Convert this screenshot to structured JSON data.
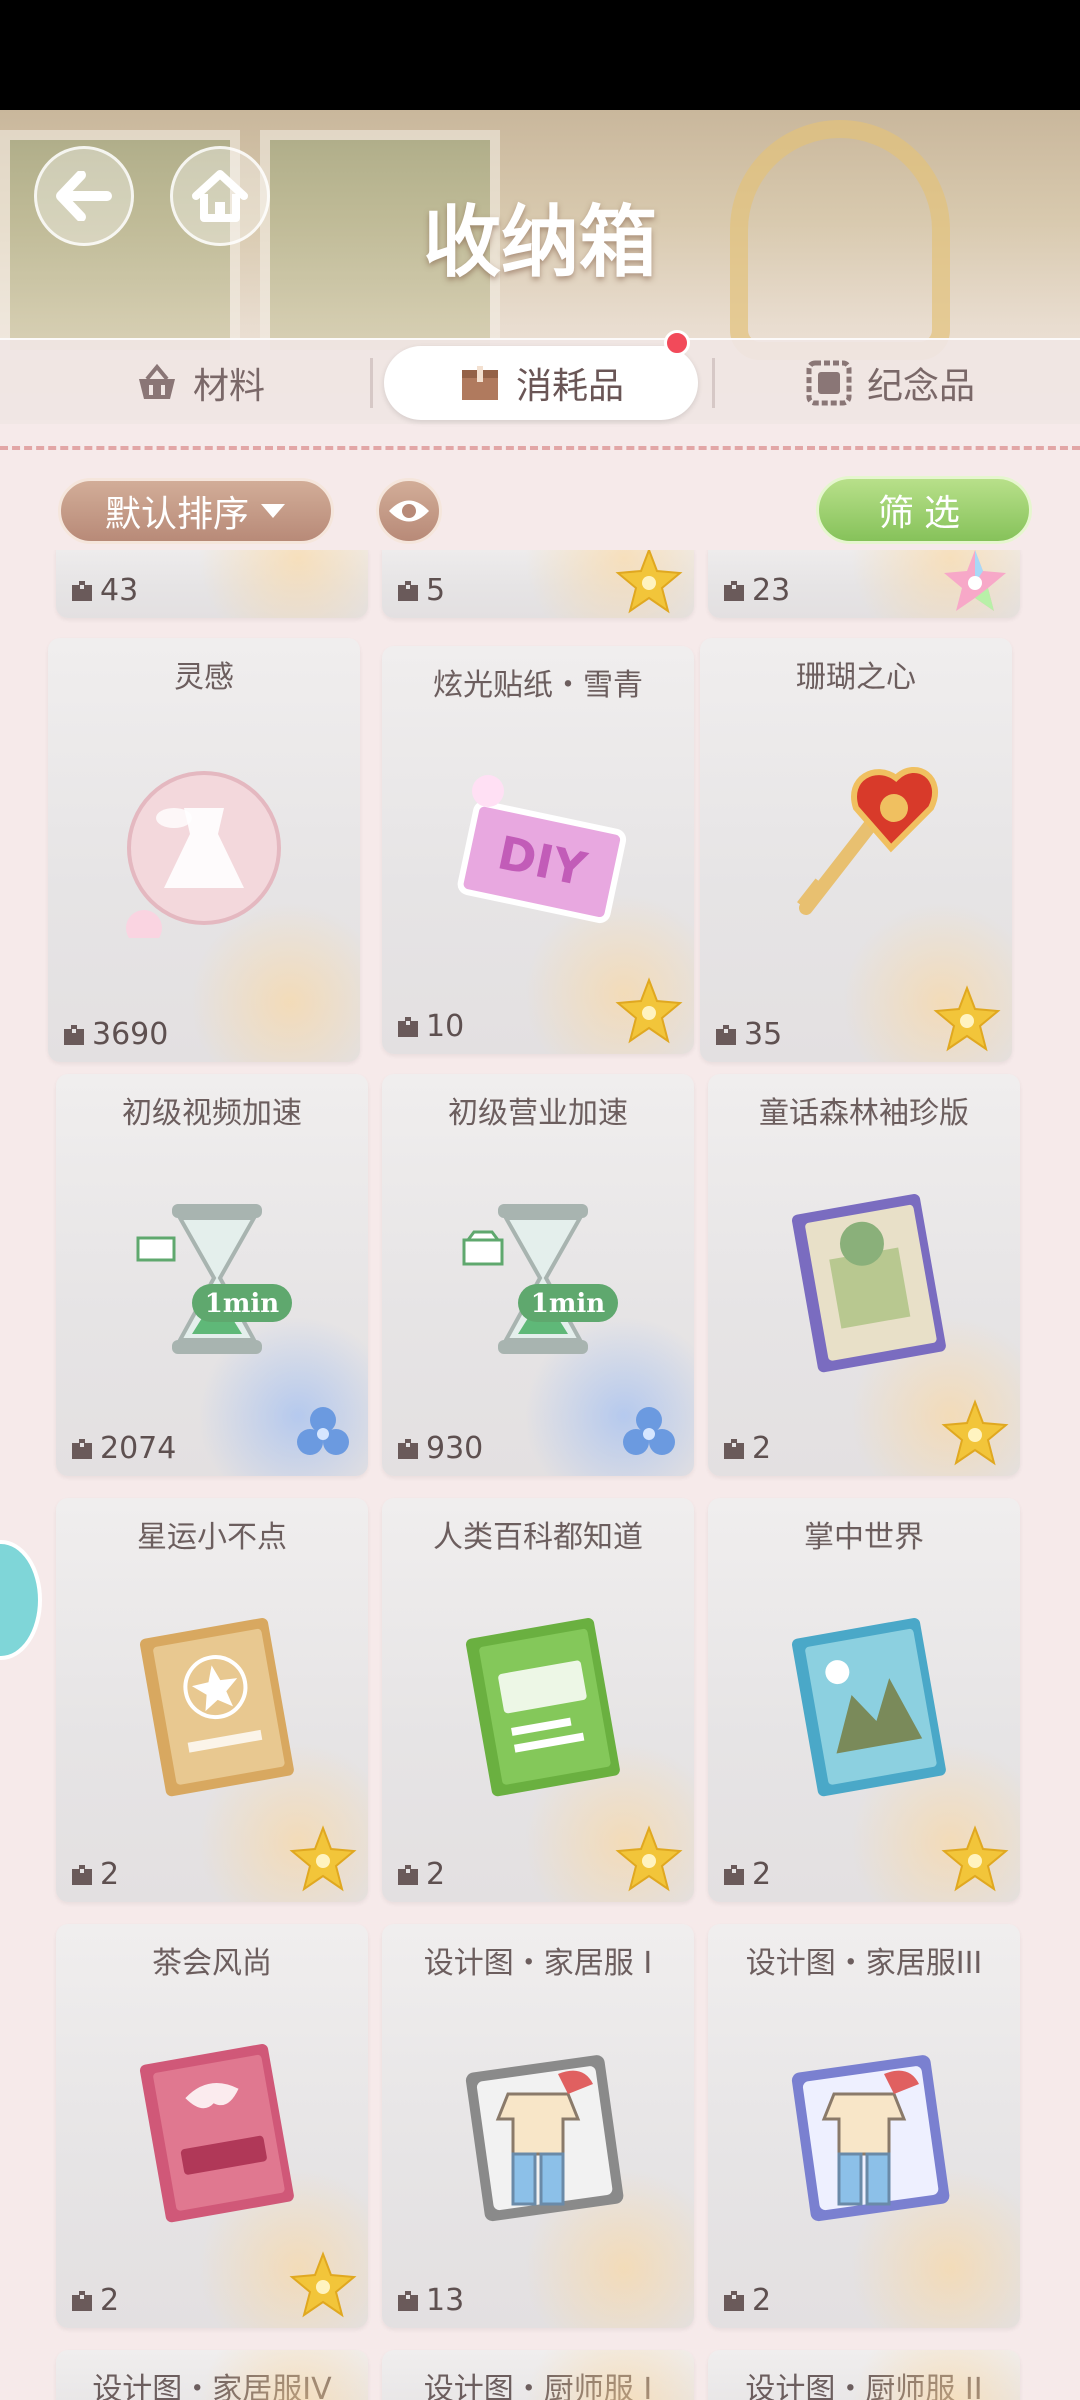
{
  "header": {
    "title": "收纳箱"
  },
  "tabs": [
    {
      "label": "材料",
      "icon": "basket-icon",
      "active": false
    },
    {
      "label": "消耗品",
      "icon": "box-icon",
      "active": true,
      "has_badge": true
    },
    {
      "label": "纪念品",
      "icon": "frame-icon",
      "active": false
    }
  ],
  "toolbar": {
    "sort_label": "默认排序",
    "filter_label": "筛选"
  },
  "colors": {
    "accent_green": "#8cc85e",
    "sort_brown": "#c49a86",
    "badge_red": "#f24a5a",
    "rarity_gold": "#f2c53a",
    "rarity_blue": "#6b9ae0"
  },
  "items_top_partial": [
    {
      "count": "43",
      "rarity": "none"
    },
    {
      "count": "5",
      "rarity": "gold-star"
    },
    {
      "count": "23",
      "rarity": "rainbow-star"
    }
  ],
  "items": [
    {
      "name": "灵感",
      "count": "3690",
      "rarity": "none",
      "icon": "dress-orb-icon"
    },
    {
      "name": "炫光贴纸・雪青",
      "count": "10",
      "rarity": "gold-star",
      "icon": "diy-sticker-icon"
    },
    {
      "name": "珊瑚之心",
      "count": "35",
      "rarity": "gold-star",
      "icon": "heart-key-icon"
    },
    {
      "name": "初级视频加速",
      "count": "2074",
      "rarity": "blue-flower",
      "icon": "hourglass-video-icon"
    },
    {
      "name": "初级营业加速",
      "count": "930",
      "rarity": "blue-flower",
      "icon": "hourglass-shop-icon"
    },
    {
      "name": "童话森林袖珍版",
      "count": "2",
      "rarity": "gold-star",
      "icon": "book-forest-icon"
    },
    {
      "name": "星运小不点",
      "count": "2",
      "rarity": "gold-star",
      "icon": "book-star-icon"
    },
    {
      "name": "人类百科都知道",
      "count": "2",
      "rarity": "gold-star",
      "icon": "book-encyclopedia-icon"
    },
    {
      "name": "掌中世界",
      "count": "2",
      "rarity": "gold-star",
      "icon": "book-world-icon"
    },
    {
      "name": "茶会风尚",
      "count": "2",
      "rarity": "gold-star",
      "icon": "book-tea-icon"
    },
    {
      "name": "设计图・家居服 I",
      "count": "13",
      "rarity": "none",
      "icon": "blueprint-icon"
    },
    {
      "name": "设计图・家居服III",
      "count": "2",
      "rarity": "none",
      "icon": "blueprint-icon"
    }
  ],
  "items_bottom_partial": [
    {
      "name": "设计图・家居服IV"
    },
    {
      "name": "设计图・厨师服 I"
    },
    {
      "name": "设计图・厨师服 II"
    }
  ],
  "hourglass_label": "1min",
  "diy_label": "DIY"
}
